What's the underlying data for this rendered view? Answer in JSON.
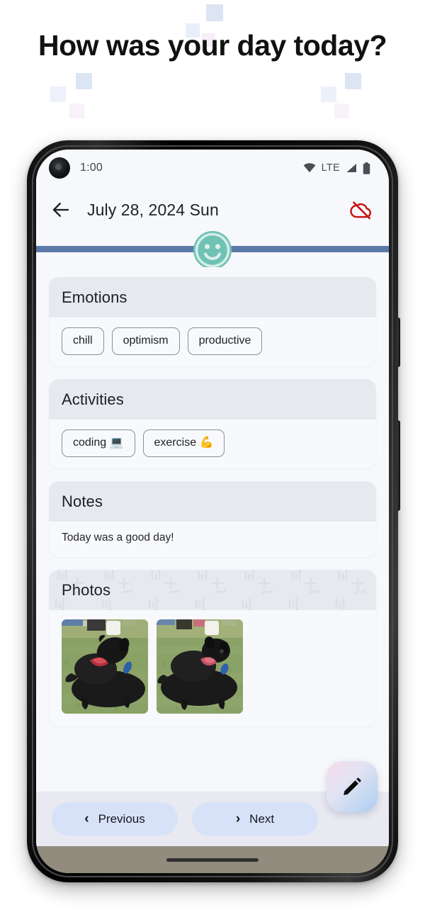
{
  "promo": {
    "headline": "How was your day today?",
    "decor_blue": "#DCE5F4",
    "decor_pink": "#F7EFF8"
  },
  "status_bar": {
    "time": "1:00",
    "network_label": "LTE",
    "icons": [
      "wifi-icon",
      "signal-icon",
      "battery-icon"
    ],
    "icon_color": "#4a4e54"
  },
  "app_bar": {
    "back_icon": "back-arrow-icon",
    "title": "July 28, 2024 Sun",
    "sync_icon": "cloud-off-icon",
    "sync_icon_color": "#C81515"
  },
  "mood_slider": {
    "icon": "smiley-face-icon",
    "track_color": "#5C7AA8",
    "face_color": "#6FC2B4",
    "position_percent": 50
  },
  "cards": [
    {
      "title": "Emotions",
      "type": "chips",
      "chips": [
        "chill",
        "optimism",
        "productive"
      ]
    },
    {
      "title": "Activities",
      "type": "chips",
      "chips": [
        "coding 💻",
        "exercise 💪"
      ]
    },
    {
      "title": "Notes",
      "type": "text",
      "text": "Today was a good day!"
    },
    {
      "title": "Photos",
      "type": "photos",
      "photo_count": 2,
      "photo_alt": [
        "black-labrador-on-grass",
        "black-labrador-on-grass"
      ]
    }
  ],
  "fab": {
    "icon": "pencil-edit-icon",
    "gradient_from": "#F6DCEA",
    "gradient_to": "#AECBF0"
  },
  "bottom_nav": {
    "previous_label": "Previous",
    "previous_icon": "chevron-left-icon",
    "next_label": "Next",
    "next_icon": "chevron-right-icon",
    "pill_color": "#D7E2F8",
    "bar_color": "#E8E9F1"
  },
  "system_nav": {
    "bar_color": "#918C7E",
    "home_indicator": "home-indicator"
  },
  "theme": {
    "screen_bg": "#F7F8FC",
    "card_header_bg": "#E8E8EF",
    "card_body_bg": "#F8F9FC",
    "text_primary": "#1d1f24"
  }
}
